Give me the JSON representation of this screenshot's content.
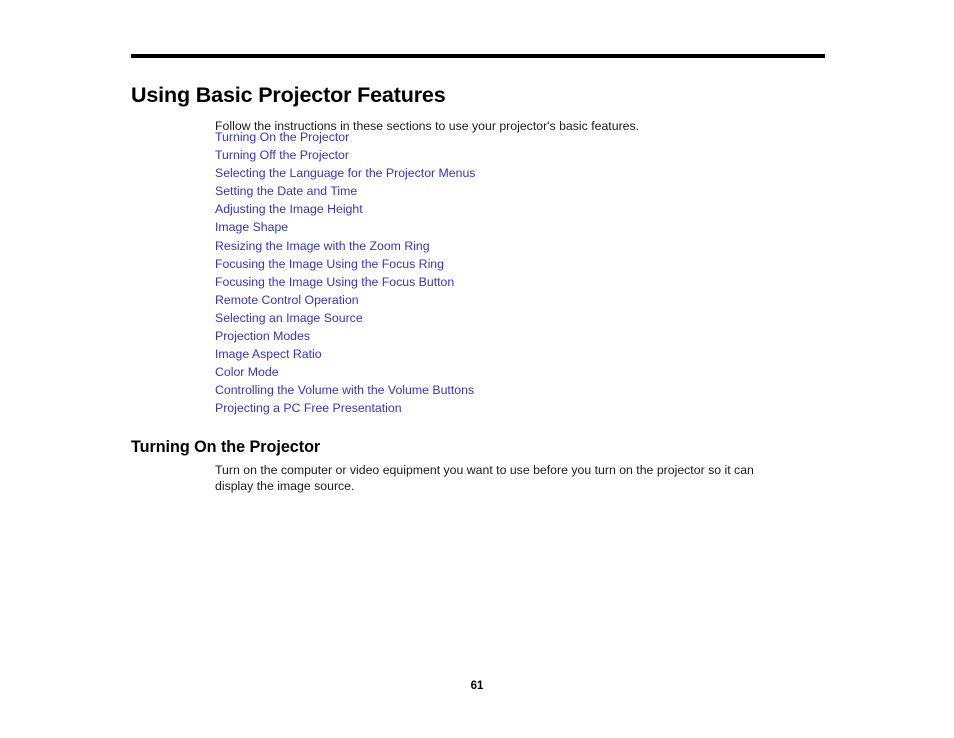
{
  "document": {
    "title": "Using Basic Projector Features",
    "intro": "Follow the instructions in these sections to use your projector's basic features.",
    "page_number": "61"
  },
  "colors": {
    "link": "#3333CC",
    "text": "#1A1A1A",
    "rule": "#000000"
  },
  "links": [
    {
      "label": "Turning On the Projector"
    },
    {
      "label": "Turning Off the Projector"
    },
    {
      "label": "Selecting the Language for the Projector Menus"
    },
    {
      "label": "Setting the Date and Time"
    },
    {
      "label": "Adjusting the Image Height"
    },
    {
      "label": "Image Shape"
    },
    {
      "label": "Resizing the Image with the Zoom Ring"
    },
    {
      "label": "Focusing the Image Using the Focus Ring"
    },
    {
      "label": "Focusing the Image Using the Focus Button"
    },
    {
      "label": "Remote Control Operation"
    },
    {
      "label": "Selecting an Image Source"
    },
    {
      "label": "Projection Modes"
    },
    {
      "label": "Image Aspect Ratio"
    },
    {
      "label": "Color Mode"
    },
    {
      "label": "Controlling the Volume with the Volume Buttons"
    },
    {
      "label": "Projecting a PC Free Presentation"
    }
  ],
  "section": {
    "heading": "Turning On the Projector",
    "body": "Turn on the computer or video equipment you want to use before you turn on the projector so it can display the image source."
  }
}
